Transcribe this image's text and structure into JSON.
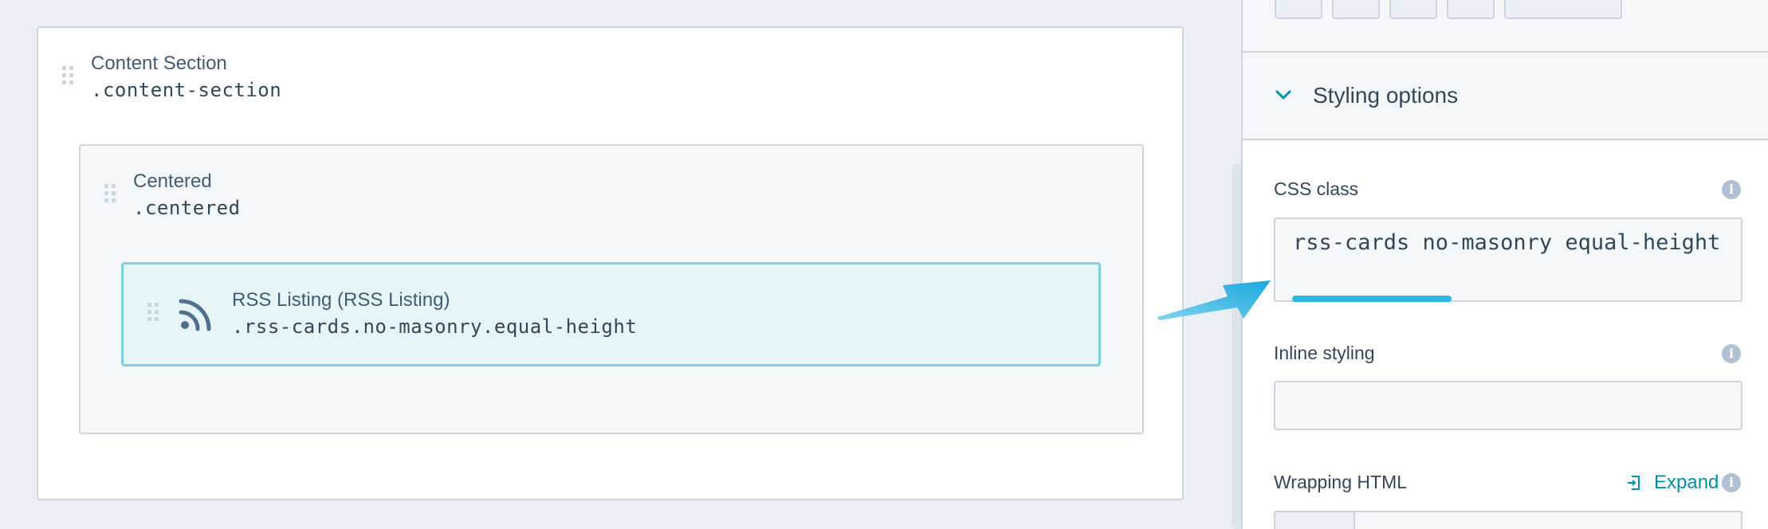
{
  "canvas": {
    "section": {
      "title": "Content Section",
      "class_name": ".content-section"
    },
    "centered": {
      "title": "Centered",
      "class_name": ".centered"
    },
    "rss": {
      "title": "RSS Listing (RSS Listing)",
      "class_name": ".rss-cards.no-masonry.equal-height",
      "icon": "rss-icon"
    }
  },
  "panel": {
    "styling_header": "Styling options",
    "css_class": {
      "label": "CSS class",
      "value": "rss-cards no-masonry equal-height"
    },
    "inline_styling": {
      "label": "Inline styling",
      "value": ""
    },
    "wrapping_html": {
      "label": "Wrapping HTML",
      "expand_label": "Expand"
    }
  },
  "colors": {
    "accent": "#0091ae",
    "highlight_underline": "#2fb7e4",
    "selected_module_border": "#7fd1de",
    "selected_module_bg": "#e5f5f8"
  }
}
